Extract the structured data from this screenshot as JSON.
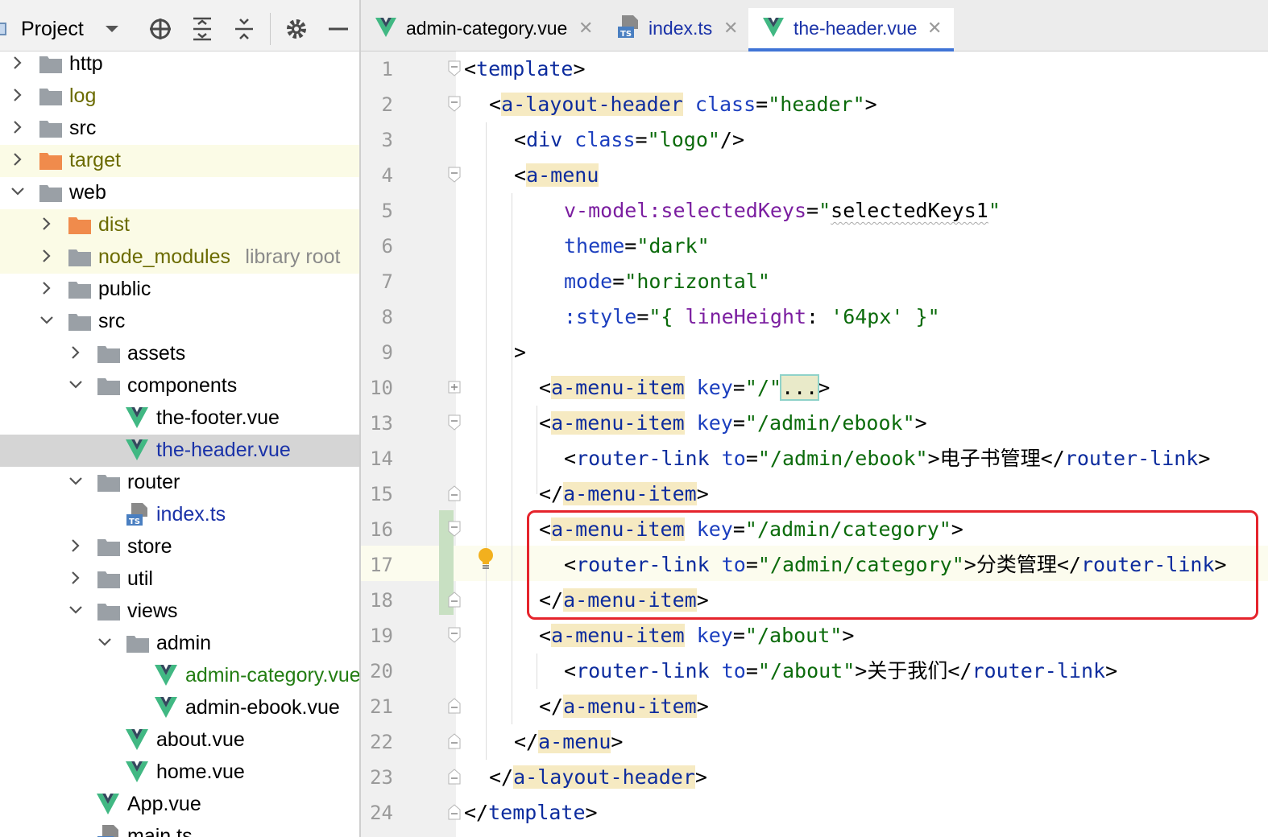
{
  "project_panel": {
    "title": "Project",
    "toolbar_icons": [
      "dropdown-arrow-icon",
      "locate-target-icon",
      "expand-all-icon",
      "collapse-all-icon",
      "gear-icon",
      "minimize-icon"
    ]
  },
  "tree": [
    {
      "label": "http",
      "type": "folder",
      "depth": 0,
      "state": "collapsed"
    },
    {
      "label": "log",
      "type": "folder",
      "depth": 0,
      "state": "collapsed",
      "color": "olive"
    },
    {
      "label": "src",
      "type": "folder",
      "depth": 0,
      "state": "collapsed"
    },
    {
      "label": "target",
      "type": "folder-orange",
      "depth": 0,
      "state": "collapsed",
      "color": "olive"
    },
    {
      "label": "web",
      "type": "folder",
      "depth": 0,
      "state": "expanded"
    },
    {
      "label": "dist",
      "type": "folder-orange",
      "depth": 1,
      "state": "collapsed",
      "color": "olive"
    },
    {
      "label": "node_modules",
      "sub": "library root",
      "type": "folder",
      "depth": 1,
      "state": "collapsed",
      "color": "olive"
    },
    {
      "label": "public",
      "type": "folder",
      "depth": 1,
      "state": "collapsed"
    },
    {
      "label": "src",
      "type": "folder",
      "depth": 1,
      "state": "expanded"
    },
    {
      "label": "assets",
      "type": "folder",
      "depth": 2,
      "state": "collapsed"
    },
    {
      "label": "components",
      "type": "folder",
      "depth": 2,
      "state": "expanded"
    },
    {
      "label": "the-footer.vue",
      "type": "vue",
      "depth": 3
    },
    {
      "label": "the-header.vue",
      "type": "vue",
      "depth": 3,
      "color": "blue",
      "selected": true
    },
    {
      "label": "router",
      "type": "folder",
      "depth": 2,
      "state": "expanded"
    },
    {
      "label": "index.ts",
      "type": "ts",
      "depth": 3,
      "color": "blue"
    },
    {
      "label": "store",
      "type": "folder",
      "depth": 2,
      "state": "collapsed"
    },
    {
      "label": "util",
      "type": "folder",
      "depth": 2,
      "state": "collapsed"
    },
    {
      "label": "views",
      "type": "folder",
      "depth": 2,
      "state": "expanded"
    },
    {
      "label": "admin",
      "type": "folder",
      "depth": 3,
      "state": "expanded"
    },
    {
      "label": "admin-category.vue",
      "type": "vue",
      "depth": 4,
      "color": "green"
    },
    {
      "label": "admin-ebook.vue",
      "type": "vue",
      "depth": 4
    },
    {
      "label": "about.vue",
      "type": "vue",
      "depth": 3
    },
    {
      "label": "home.vue",
      "type": "vue",
      "depth": 3
    },
    {
      "label": "App.vue",
      "type": "vue",
      "depth": 2
    },
    {
      "label": "main.ts",
      "type": "ts",
      "depth": 2
    }
  ],
  "tabs": [
    {
      "label": "admin-category.vue",
      "icon": "vue-icon",
      "color": "#227d12",
      "active": false
    },
    {
      "label": "index.ts",
      "icon": "ts-file-icon",
      "color": "#1a32a8",
      "active": false
    },
    {
      "label": "the-header.vue",
      "icon": "vue-icon",
      "color": "#1a32a8",
      "active": true
    }
  ],
  "line_numbers": [
    "1",
    "2",
    "3",
    "4",
    "5",
    "6",
    "7",
    "8",
    "9",
    "10",
    "13",
    "14",
    "15",
    "16",
    "17",
    "18",
    "19",
    "20",
    "21",
    "22",
    "23",
    "24"
  ],
  "code": {
    "l1_tag": "template",
    "l2_tag": "a-layout-header",
    "l2_attr": "class",
    "l2_val": "\"header\"",
    "l3_tag": "div",
    "l3_attr": "class",
    "l3_val": "\"logo\"",
    "l4_tag": "a-menu",
    "l5_attr": "v-model:selectedKeys",
    "l5_val_q1": "\"",
    "l5_val": "selectedKeys1",
    "l5_val_q2": "\"",
    "l6_attr": "theme",
    "l6_val": "\"dark\"",
    "l7_attr": "mode",
    "l7_val": "\"horizontal\"",
    "l8_attr": ":style",
    "l8_val_open": "\"{ ",
    "l8_key": "lineHeight",
    "l8_colon": ": ",
    "l8_str": "'64px'",
    "l8_val_close": " }\"",
    "l9": ">",
    "l10_tag": "a-menu-item",
    "l10_attr": "key",
    "l10_val": "\"/\"",
    "l10_dots": "...",
    "l13_tag": "a-menu-item",
    "l13_attr": "key",
    "l13_val": "\"/admin/ebook\"",
    "l14_tag": "router-link",
    "l14_attr": "to",
    "l14_val": "\"/admin/ebook\"",
    "l14_text": "电子书管理",
    "l14_ctag": "router-link",
    "l15_tag": "a-menu-item",
    "l16_tag": "a-menu-item",
    "l16_attr": "key",
    "l16_val": "\"/admin/category\"",
    "l17_tag": "router-link",
    "l17_attr": "to",
    "l17_val": "\"/admin/category\"",
    "l17_text": "分类管理",
    "l17_ctag": "router-link",
    "l18_tag": "a-menu-item",
    "l19_tag": "a-menu-item",
    "l19_attr": "key",
    "l19_val": "\"/about\"",
    "l20_tag": "router-link",
    "l20_attr": "to",
    "l20_val": "\"/about\"",
    "l20_text": "关于我们",
    "l20_ctag": "router-link",
    "l21_tag": "a-menu-item",
    "l22_tag": "a-menu",
    "l23_tag": "a-layout-header",
    "l24_tag": "template"
  },
  "colors": {
    "accent_tab_underline": "#3f74d6",
    "annotation_box": "#e5242c",
    "tag": "#0d2c9e",
    "attribute": "#1c3fbf",
    "string": "#0b6b0b",
    "vue_green": "#41b883",
    "vue_dark": "#34495e"
  }
}
